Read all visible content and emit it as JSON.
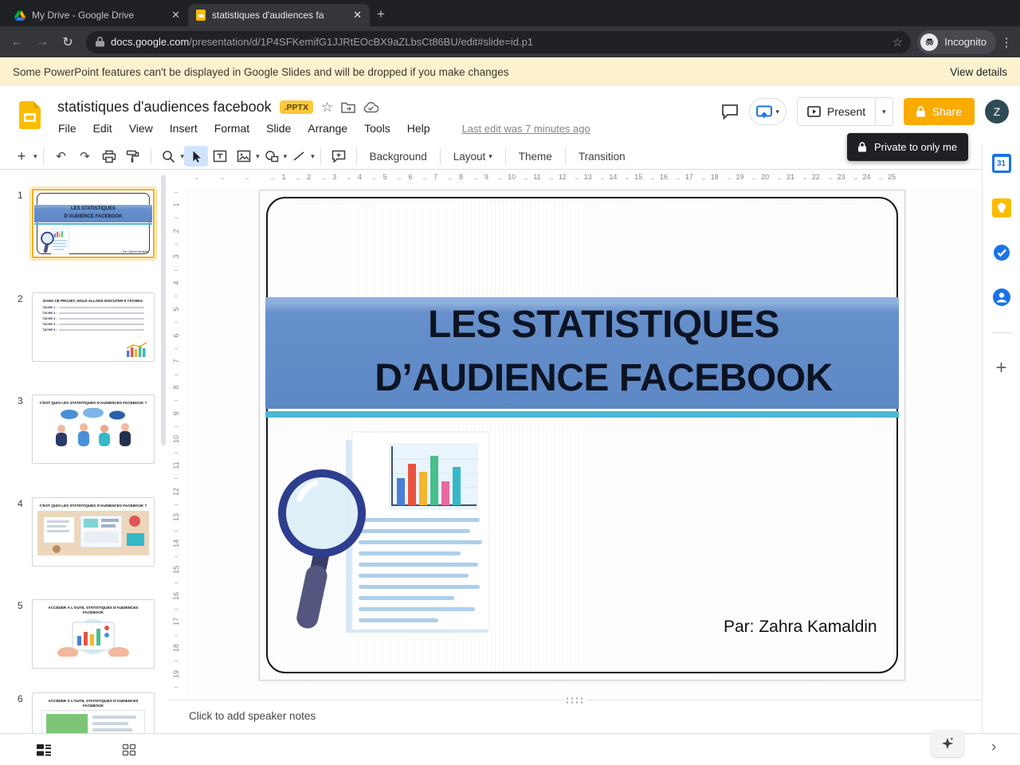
{
  "browser": {
    "tabs": [
      {
        "title": "My Drive - Google Drive"
      },
      {
        "title": "statistiques d'audiences fa"
      }
    ],
    "new_tab": "+",
    "url_domain": "docs.google.com",
    "url_path": "/presentation/d/1P4SFKemifG1JJRtEOcBX9aZLbsCt86BU/edit#slide=id.p1",
    "incognito_label": "Incognito"
  },
  "notice": {
    "message": "Some PowerPoint features can't be displayed in Google Slides and will be dropped if you make changes",
    "action": "View details"
  },
  "app": {
    "title": "statistiques d'audiences facebook",
    "badge": ".PPTX",
    "menus": [
      "File",
      "Edit",
      "View",
      "Insert",
      "Format",
      "Slide",
      "Arrange",
      "Tools",
      "Help"
    ],
    "last_edit": "Last edit was 7 minutes ago",
    "present_label": "Present",
    "share_label": "Share",
    "avatar_letter": "Z",
    "tooltip": "Private to only me"
  },
  "toolbar": {
    "background": "Background",
    "layout": "Layout",
    "theme": "Theme",
    "transition": "Transition"
  },
  "slide": {
    "title_line1": "LES STATISTIQUES",
    "title_line2": "D’AUDIENCE FACEBOOK",
    "author": "Par: Zahra Kamaldin"
  },
  "filmstrip": {
    "slides": [
      {
        "n": "1",
        "title1": "LES STATISTIQUES",
        "title2": "D’AUDIENCE FACEBOOK",
        "author": "Par: Zahra Kamaldin"
      },
      {
        "n": "2",
        "title": "DANS CE PROJET, NOUS ALLONS DISCUTER 5 TÂCHES:",
        "items": [
          "TÂCHE 1 :",
          "TÂCHE 2 :",
          "TÂCHE 3 :",
          "TÂCHE 4 :",
          "TÂCHE 5 :"
        ]
      },
      {
        "n": "3",
        "title": "C'EST QUOI LES STATISTIQUES D'AUDIENCES FACEBOOK ?"
      },
      {
        "n": "4",
        "title": "C'EST QUOI LES STATISTIQUES D'AUDIENCES FACEBOOK ?"
      },
      {
        "n": "5",
        "title": "ACCÉDER À L'OUTIL STATISTIQUES D'AUDIENCES FACEBOOK"
      },
      {
        "n": "6",
        "title": "ACCÉDER À L'OUTIL STATISTIQUES D'AUDIENCES FACEBOOK"
      }
    ]
  },
  "notes": {
    "placeholder": "Click to add speaker notes"
  },
  "rulers": {
    "horizontal": [
      1,
      2,
      3,
      4,
      5,
      6,
      7,
      8,
      9,
      10,
      11,
      12,
      13,
      14,
      15,
      16,
      17,
      18,
      19,
      20,
      21,
      22,
      23,
      24,
      25
    ],
    "vertical": [
      1,
      2,
      3,
      4,
      5,
      6,
      7,
      8,
      9,
      10,
      11,
      12,
      13,
      14,
      15,
      16,
      17,
      18,
      19
    ]
  }
}
